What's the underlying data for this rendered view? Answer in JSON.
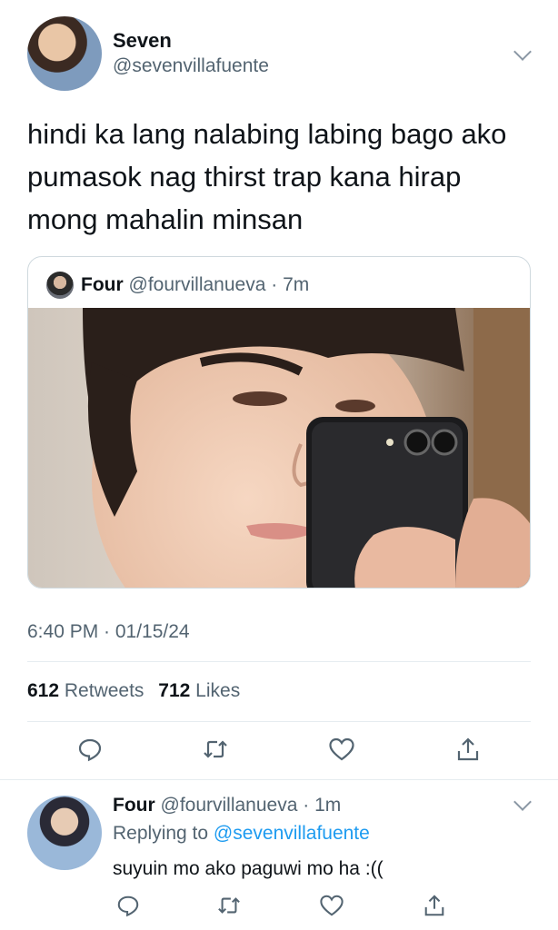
{
  "tweet": {
    "author_name": "Seven",
    "author_handle": "@sevenvillafuente",
    "text": "hindi ka lang nalabing labing bago ako pumasok nag thirst trap kana hirap mong mahalin minsan",
    "timestamp": "6:40 PM · 01/15/24",
    "stats": {
      "retweets_count": "612",
      "retweets_label": "Retweets",
      "likes_count": "712",
      "likes_label": "Likes"
    }
  },
  "quote": {
    "author_name": "Four",
    "author_handle": "@fourvillanueva",
    "separator": " · ",
    "time": "7m"
  },
  "reply": {
    "author_name": "Four",
    "author_handle": "@fourvillanueva",
    "separator": " · ",
    "time": "1m",
    "replying_to_label": "Replying to",
    "replying_to_handle": "@sevenvillafuente",
    "text": "suyuin mo ako paguwi mo ha :(("
  },
  "icons": {
    "reply": "reply-icon",
    "retweet": "retweet-icon",
    "like": "heart-icon",
    "share": "share-icon",
    "menu": "chevron-down-icon"
  },
  "colors": {
    "text": "#0f1419",
    "secondary": "#536471",
    "link": "#1d9bf0",
    "border": "#cfd9de"
  }
}
